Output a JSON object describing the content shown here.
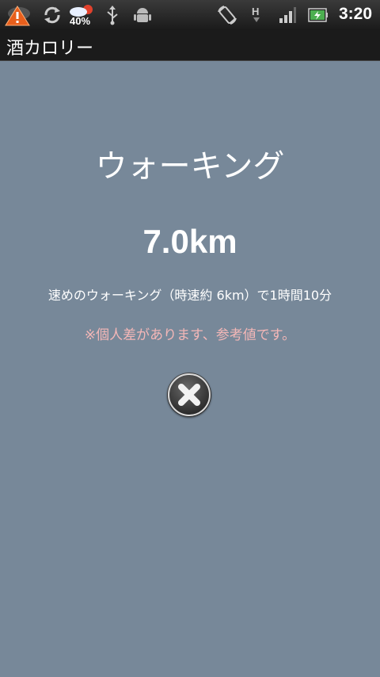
{
  "status_bar": {
    "time": "3:20",
    "weather_percent": "40%",
    "icons": [
      "warning-icon",
      "sync-icon",
      "weather-icon",
      "usb-icon",
      "android-debug-icon",
      "rotate-icon",
      "network-h-icon",
      "signal-icon",
      "battery-icon"
    ]
  },
  "title_bar": {
    "title": "酒カロリー"
  },
  "main": {
    "activity": "ウォーキング",
    "distance": "7.0km",
    "description": "速めのウォーキング（時速約 6km）で1時間10分",
    "disclaimer": "※個人差があります、参考値です。",
    "close_icon": "close-icon"
  },
  "colors": {
    "background": "#778899",
    "disclaimer": "#f4b7b7"
  }
}
